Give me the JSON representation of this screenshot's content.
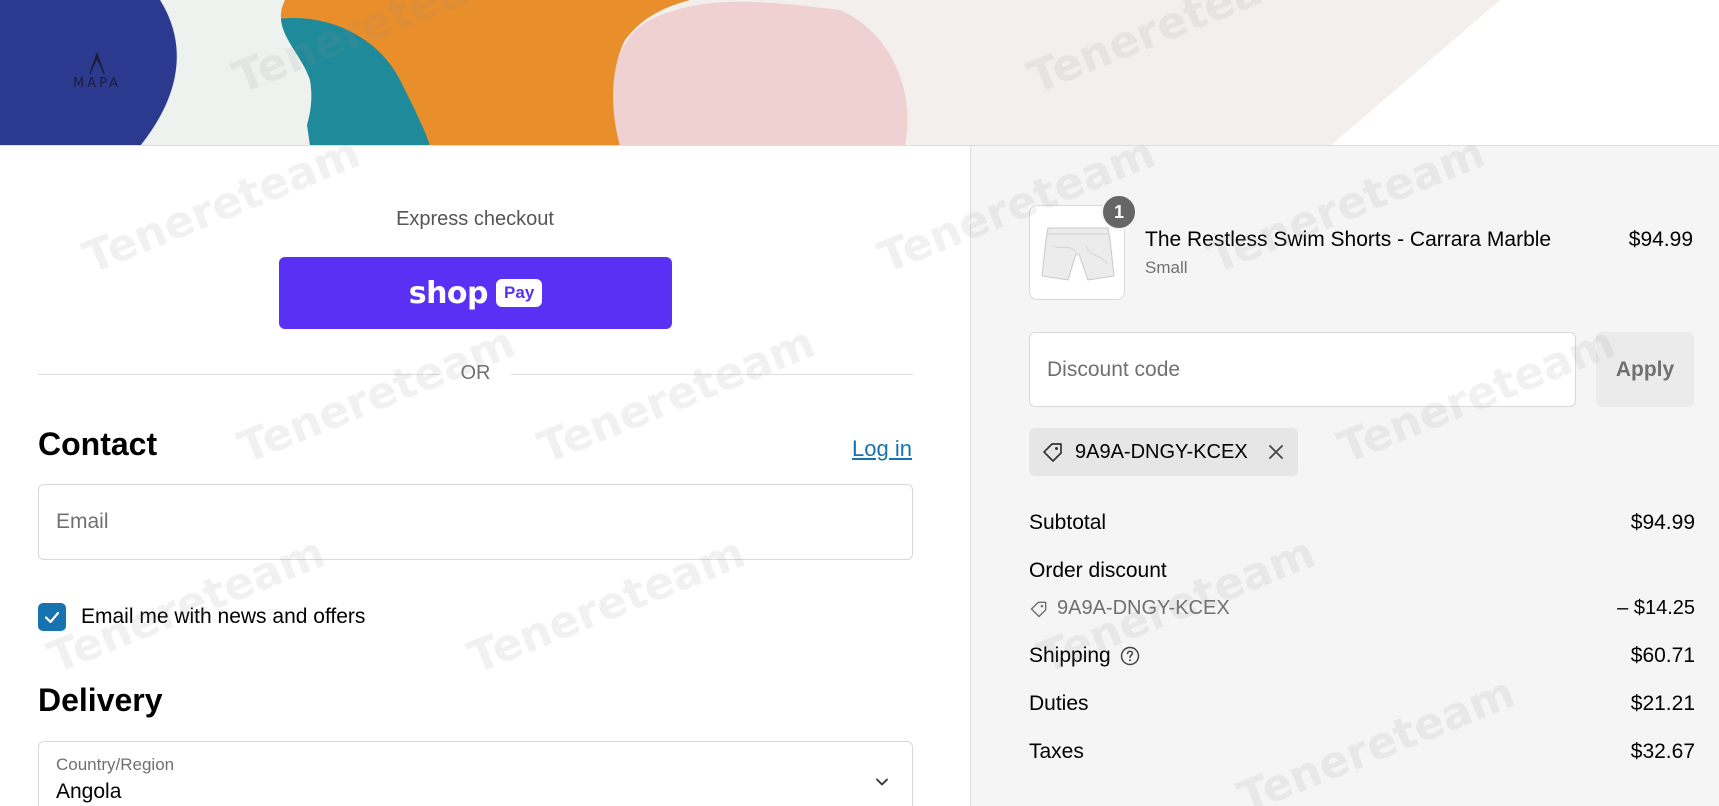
{
  "brand": {
    "logo_text": "MAPA"
  },
  "express": {
    "title": "Express checkout",
    "shop_label": "shop",
    "pay_label": "Pay",
    "or_label": "OR"
  },
  "contact": {
    "heading": "Contact",
    "login_label": "Log in",
    "email_placeholder": "Email",
    "newsletter_label": "Email me with news and offers",
    "newsletter_checked": true
  },
  "delivery": {
    "heading": "Delivery",
    "country_label": "Country/Region",
    "country_value": "Angola"
  },
  "order": {
    "item": {
      "name": "The Restless Swim Shorts - Carrara Marble",
      "variant": "Small",
      "price": "$94.99",
      "quantity": "1"
    },
    "discount_placeholder": "Discount code",
    "apply_label": "Apply",
    "applied_code": "9A9A-DNGY-KCEX",
    "summary": {
      "subtotal_label": "Subtotal",
      "subtotal_value": "$94.99",
      "discount_label": "Order discount",
      "discount_code": "9A9A-DNGY-KCEX",
      "discount_value": "– $14.25",
      "shipping_label": "Shipping",
      "shipping_value": "$60.71",
      "duties_label": "Duties",
      "duties_value": "$21.21",
      "taxes_label": "Taxes",
      "taxes_value": "$32.67"
    }
  },
  "watermark_text": "Tenereteam",
  "colors": {
    "accent": "#1773b0",
    "shop_pay": "#5a31f4",
    "muted": "#707070"
  }
}
